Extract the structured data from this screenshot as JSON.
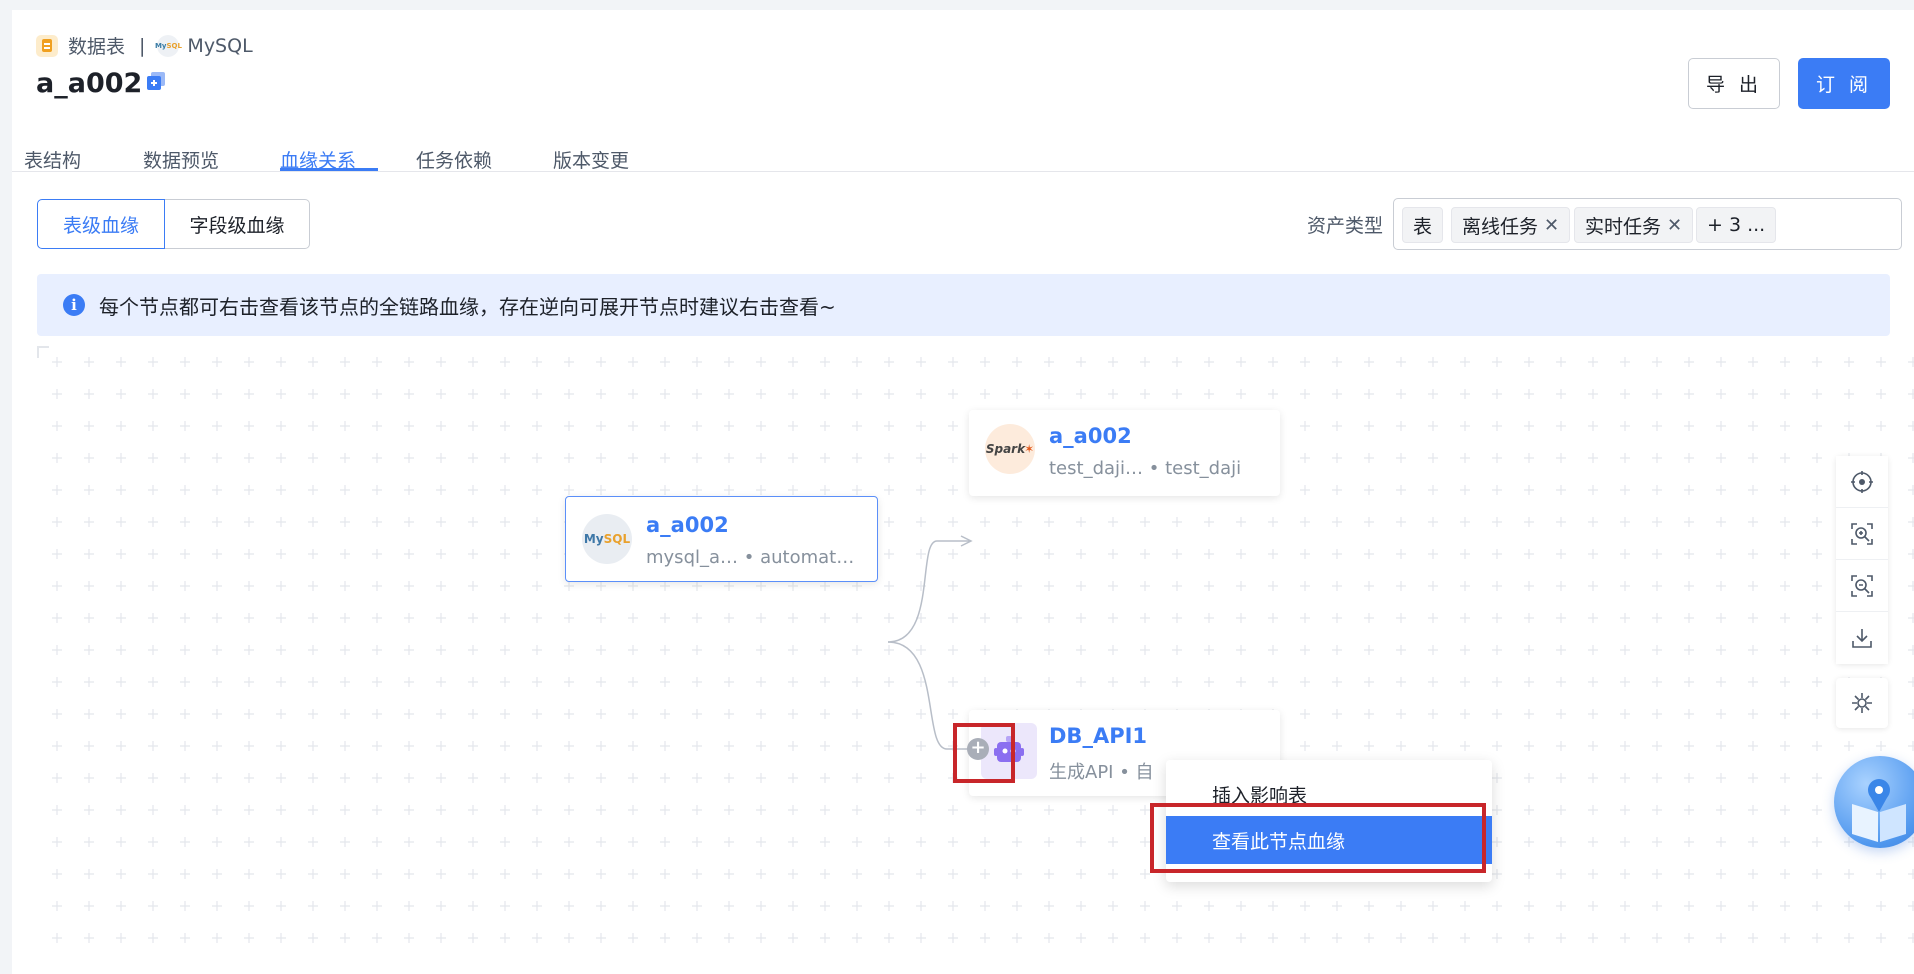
{
  "breadcrumb": {
    "type_label": "数据表",
    "separator": "|",
    "db_label": "MySQL"
  },
  "header": {
    "title": "a_a002",
    "export_label": "导 出",
    "subscribe_label": "订 阅"
  },
  "tabs": [
    {
      "label": "表结构"
    },
    {
      "label": "数据预览"
    },
    {
      "label": "血缘关系",
      "active": true
    },
    {
      "label": "任务依赖"
    },
    {
      "label": "版本变更"
    }
  ],
  "lineage_level": {
    "options": [
      "表级血缘",
      "字段级血缘"
    ],
    "selected": "表级血缘"
  },
  "asset_filter": {
    "label": "资产类型",
    "chips": [
      {
        "label": "表",
        "removable": false
      },
      {
        "label": "离线任务",
        "removable": true
      },
      {
        "label": "实时任务",
        "removable": true
      },
      {
        "label": "+ 3 ...",
        "removable": false
      }
    ]
  },
  "info": {
    "text": "每个节点都可右击查看该节点的全链路血缘，存在逆向可展开节点时建议右击查看~"
  },
  "nodes": {
    "source": {
      "name": "a_a002",
      "sub": "mysql_a… • automat…",
      "icon": "mysql-icon",
      "icon_text_a": "My",
      "icon_text_b": "SQL"
    },
    "spark": {
      "name": "a_a002",
      "sub": "test_daji… • test_daji",
      "icon": "spark-icon",
      "icon_text": "Spark"
    },
    "api": {
      "name": "DB_API1",
      "sub": "生成API • 自",
      "icon": "api-icon"
    }
  },
  "context_menu": {
    "items": [
      "插入影响表",
      "查看此节点血缘"
    ],
    "highlighted": "查看此节点血缘"
  },
  "expand_button": "+",
  "colors": {
    "primary": "#3b7cf5",
    "highlight_box": "#c8262a",
    "info_bg": "#e8efff"
  },
  "toolbar_icons": [
    "locate-icon",
    "zoom-in-icon",
    "zoom-out-icon",
    "download-icon",
    "settings-icon"
  ]
}
